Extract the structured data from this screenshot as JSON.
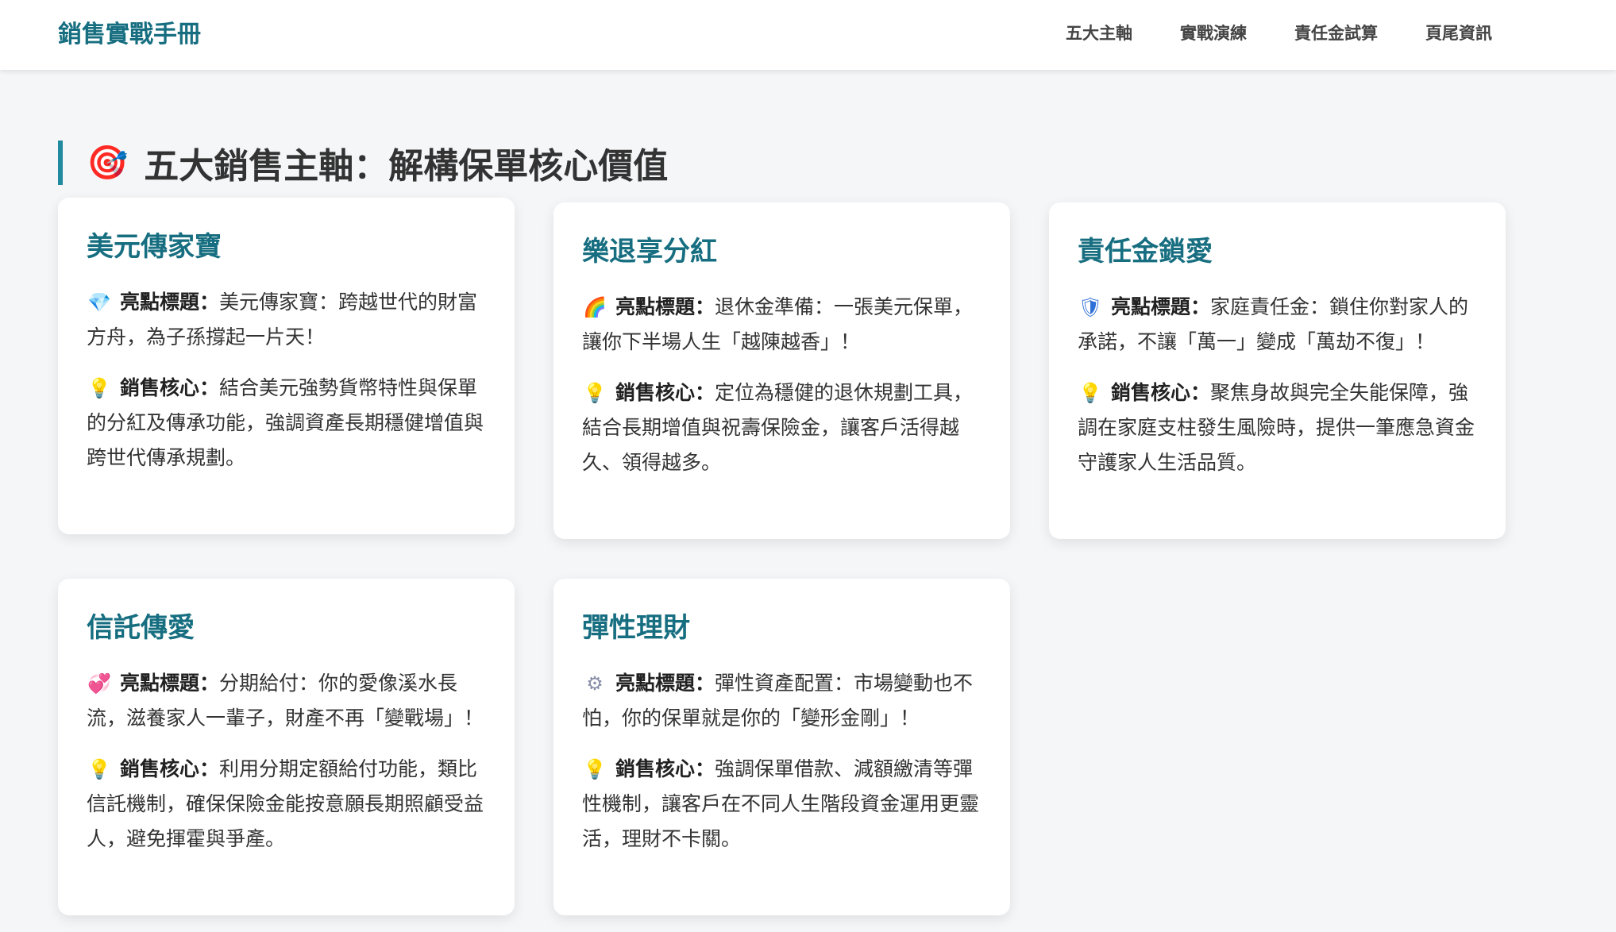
{
  "navbar": {
    "brand": "銷售實戰手冊",
    "links": [
      "五大主軸",
      "實戰演練",
      "責任金試算",
      "頁尾資訊"
    ]
  },
  "section": {
    "icon": "target-icon",
    "title": "五大銷售主軸：解構保單核心價值"
  },
  "labels": {
    "highlight": "亮點標題：",
    "core": "銷售核心："
  },
  "cards": [
    {
      "title": "美元傳家寶",
      "highlight_icon": "gem-icon",
      "highlight": "美元傳家寶：跨越世代的財富方舟，為子孫撐起一片天！",
      "core_icon": "lightbulb-icon",
      "core": "結合美元強勢貨幣特性與保單的分紅及傳承功能，強調資產長期穩健增值與跨世代傳承規劃。"
    },
    {
      "title": "樂退享分紅",
      "highlight_icon": "rainbow-icon",
      "highlight": "退休金準備：一張美元保單，讓你下半場人生「越陳越香」！",
      "core_icon": "lightbulb-icon",
      "core": "定位為穩健的退休規劃工具，結合長期增值與祝壽保險金，讓客戶活得越久、領得越多。"
    },
    {
      "title": "責任金鎖愛",
      "highlight_icon": "shield-icon",
      "highlight": "家庭責任金：鎖住你對家人的承諾，不讓「萬一」變成「萬劫不復」！",
      "core_icon": "lightbulb-icon",
      "core": "聚焦身故與完全失能保障，強調在家庭支柱發生風險時，提供一筆應急資金守護家人生活品質。"
    },
    {
      "title": "信託傳愛",
      "highlight_icon": "hearts-icon",
      "highlight": "分期給付：你的愛像溪水長流，滋養家人一輩子，財產不再「變戰場」！",
      "core_icon": "lightbulb-icon",
      "core": "利用分期定額給付功能，類比信託機制，確保保險金能按意願長期照顧受益人，避免揮霍與爭產。"
    },
    {
      "title": "彈性理財",
      "highlight_icon": "gear-icon",
      "highlight": "彈性資產配置：市場變動也不怕，你的保單就是你的「變形金剛」！",
      "core_icon": "lightbulb-icon",
      "core": "強調保單借款、減額繳清等彈性機制，讓客戶在不同人生階段資金運用更靈活，理財不卡關。"
    }
  ]
}
